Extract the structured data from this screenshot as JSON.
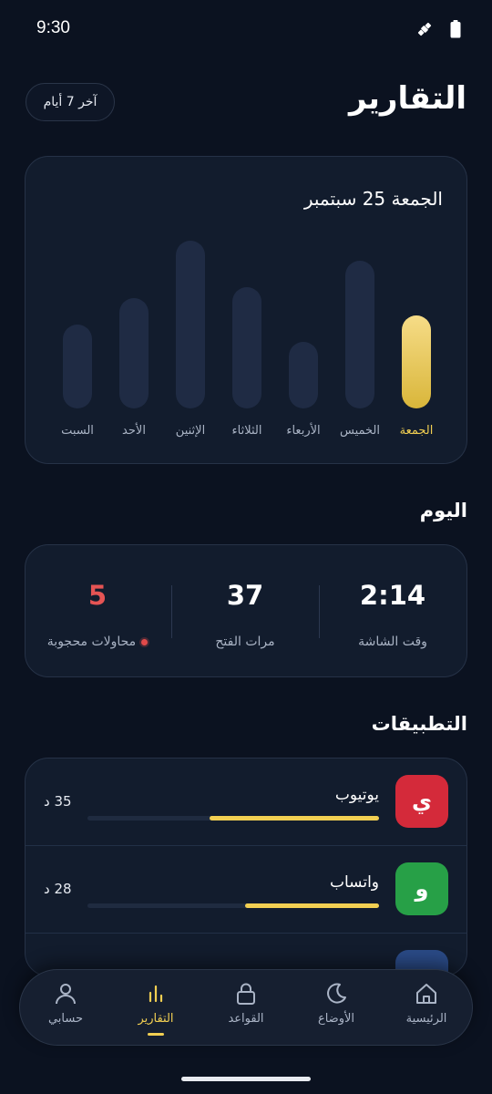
{
  "status_bar": {
    "time": "9:30",
    "icons": [
      "satellite-icon",
      "battery-icon"
    ]
  },
  "header": {
    "title": "التقارير",
    "range_label": "آخر 7 أيام"
  },
  "chart_data": {
    "type": "bar",
    "title": "الجمعة 25 سبتمبر",
    "categories": [
      "الجمعة",
      "الخميس",
      "الأربعاء",
      "الثلاثاء",
      "الإثنين",
      "الأحد",
      "السبت"
    ],
    "values": [
      102,
      162,
      73,
      133,
      184,
      121,
      92
    ],
    "highlighted_category": "الجمعة",
    "grid": false,
    "colors": {
      "bar": "#1f2b44",
      "highlight_top": "#f6dc87",
      "highlight_bottom": "#d9b63a",
      "highlight_label": "#f2cf52",
      "label": "#a9b3c4"
    }
  },
  "today": {
    "title": "اليوم",
    "stats": [
      {
        "value": "2:14",
        "label": "وقت الشاشة",
        "color": "#ffffff"
      },
      {
        "value": "37",
        "label": "مرات الفتح",
        "color": "#ffffff"
      },
      {
        "value": "5",
        "label": "محاولات محجوبة",
        "color": "#e55454"
      }
    ]
  },
  "apps": {
    "title": "التطبيقات",
    "items": [
      {
        "name": "يوتيوب",
        "letter": "ي",
        "time": "35 د",
        "usage_fraction": 0.58,
        "color": "#d42a3a"
      },
      {
        "name": "واتساب",
        "letter": "و",
        "time": "28 د",
        "usage_fraction": 0.46,
        "color": "#27a047"
      },
      {
        "name": "",
        "letter": "",
        "time": "",
        "usage_fraction": 0,
        "color": "#2a4a86"
      }
    ]
  },
  "nav": {
    "items": [
      {
        "label": "الرئيسية",
        "icon": "home-icon",
        "active": false
      },
      {
        "label": "الأوضاع",
        "icon": "moon-icon",
        "active": false
      },
      {
        "label": "القواعد",
        "icon": "lock-icon",
        "active": false
      },
      {
        "label": "التقارير",
        "icon": "bar-chart-icon",
        "active": true
      },
      {
        "label": "حسابي",
        "icon": "user-icon",
        "active": false
      }
    ]
  }
}
